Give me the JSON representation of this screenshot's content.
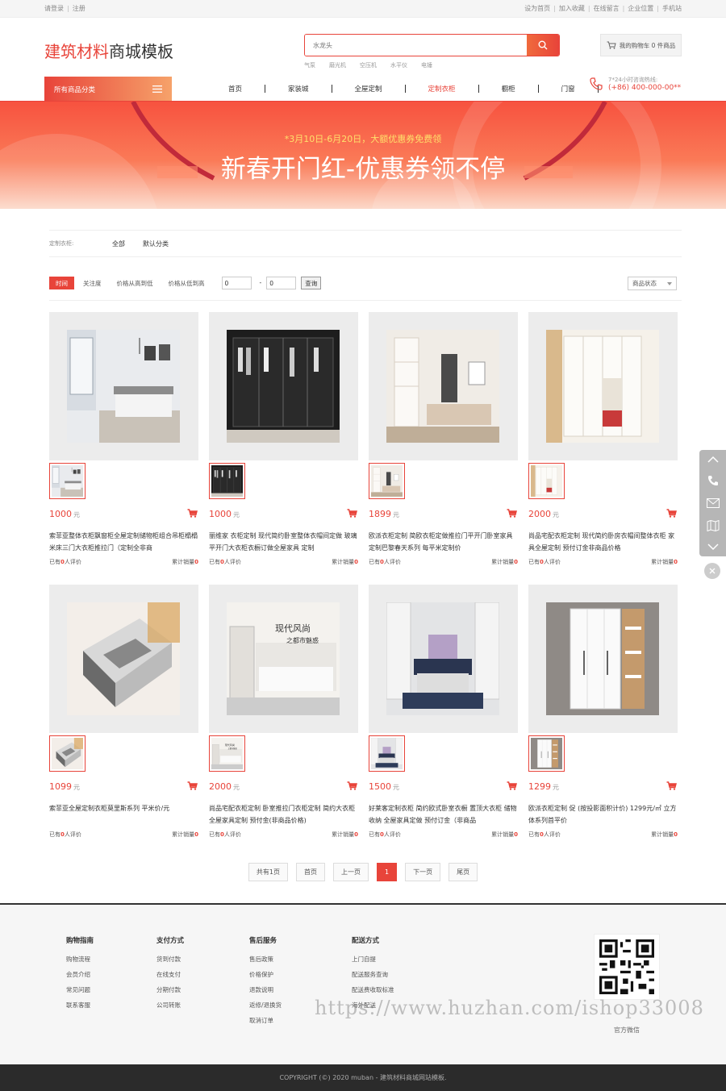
{
  "topbar": {
    "login": "请登录",
    "register": "注册",
    "links": [
      "设为首页",
      "加入收藏",
      "在线留言",
      "企业位置",
      "手机站"
    ]
  },
  "logo": {
    "part1": "建筑材料",
    "part2": "商城模板"
  },
  "search": {
    "placeholder": "水龙头",
    "hotwords": [
      "气泵",
      "磨光机",
      "空压机",
      "水平仪",
      "电锤"
    ]
  },
  "cart": {
    "label": "我的购物车 0 件商品"
  },
  "category": {
    "label": "所有商品分类"
  },
  "nav": {
    "items": [
      "首页",
      "家装城",
      "全屋定制",
      "定制衣柜",
      "橱柜",
      "门窗"
    ],
    "active": 3
  },
  "hotline": {
    "label": "7*24小时咨询热线:",
    "number": "(+86) 400-000-00**"
  },
  "banner": {
    "sub": "*3月10日-6月20日，大额优惠券免费领",
    "title": "新春开门红-优惠券领不停"
  },
  "filter": {
    "label": "定制衣柜:",
    "options": [
      "全部",
      "默认分类"
    ]
  },
  "sort": {
    "items": [
      "时间",
      "关注度",
      "价格从高到低",
      "价格从低到高"
    ],
    "min": "0",
    "max": "0",
    "query": "查询",
    "status": "商品状态"
  },
  "product_meta": {
    "unit": "元",
    "review_prefix": "已有",
    "review_suffix": "人评价",
    "sales_label": "累计销量"
  },
  "products": [
    {
      "price": "1000",
      "title": "索菲亚整体衣柜飘窗柜全屋定制储物柜组合吊柜榻榻米床三门大衣柜推拉门（定制全非商",
      "reviews": "0",
      "sales": "0"
    },
    {
      "price": "1000",
      "title": "丽维家 衣柜定制 现代简约卧室整体衣帽间定做 玻璃平开门大衣柜衣橱订做全屋家具 定制",
      "reviews": "0",
      "sales": "0"
    },
    {
      "price": "1899",
      "title": "欧派衣柜定制 简欧衣柜定做推拉门平开门卧室家具定制巴黎春天系列 每平米定制价",
      "reviews": "0",
      "sales": "0"
    },
    {
      "price": "2000",
      "title": "尚品宅配衣柜定制 现代简约卧房衣帽间整体衣柜 家具全屋定制 预付订金非商品价格",
      "reviews": "0",
      "sales": "0"
    },
    {
      "price": "1099",
      "title": "索菲亚全屋定制衣柜莫里斯系列 平米价/元",
      "reviews": "0",
      "sales": "0"
    },
    {
      "price": "2000",
      "title": "尚品宅配衣柜定制 卧室推拉门衣柜定制 简约大衣柜 全屋家具定制 预付金(非商品价格)",
      "reviews": "0",
      "sales": "0"
    },
    {
      "price": "1500",
      "title": "好莱客定制衣柜 简约欧式卧室衣橱 置顶大衣柜 储物收纳 全屋家具定做 预付订金（非商品",
      "reviews": "0",
      "sales": "0"
    },
    {
      "price": "1299",
      "title": "欧派衣柜定制 促 (按投影面积计价) 1299元/㎡ 立方体系列首平价",
      "reviews": "0",
      "sales": "0"
    }
  ],
  "pager": {
    "total": "共有1页",
    "first": "首页",
    "prev": "上一页",
    "current": "1",
    "next": "下一页",
    "last": "尾页"
  },
  "footer": {
    "cols": [
      {
        "title": "购物指南",
        "items": [
          "购物流程",
          "会员介绍",
          "常见问题",
          "联系客服"
        ]
      },
      {
        "title": "支付方式",
        "items": [
          "货到付款",
          "在线支付",
          "分期付款",
          "公司转账"
        ]
      },
      {
        "title": "售后服务",
        "items": [
          "售后政策",
          "价格保护",
          "退款说明",
          "返修/退换货",
          "取消订单"
        ]
      },
      {
        "title": "配送方式",
        "items": [
          "上门自提",
          "配送服务查询",
          "配送费收取标准",
          "海外配送"
        ]
      }
    ],
    "qr_label": "官方微信"
  },
  "copyright": "COPYRIGHT (©) 2020 muban - 建筑材料商城网站模板.",
  "watermark": "https://www.huzhan.com/ishop33008",
  "colors": {
    "accent": "#e8443a",
    "footer_bg": "#2b2b2b"
  }
}
